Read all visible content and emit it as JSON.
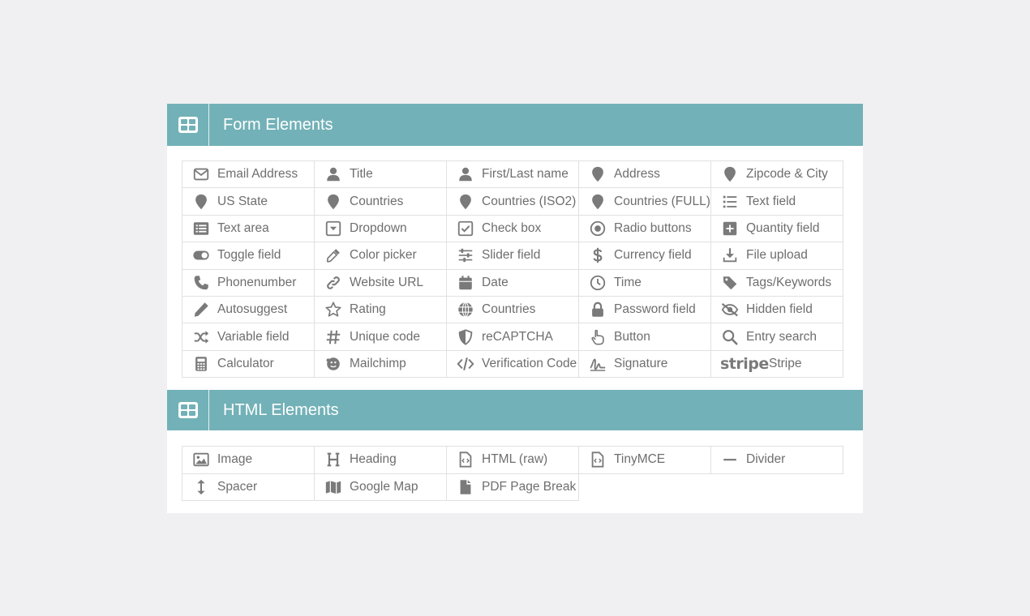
{
  "form_section": {
    "title": "Form Elements",
    "items": [
      {
        "label": "Email Address",
        "icon": "envelope-icon"
      },
      {
        "label": "Title",
        "icon": "user-icon"
      },
      {
        "label": "First/Last name",
        "icon": "user-icon"
      },
      {
        "label": "Address",
        "icon": "map-pin-icon"
      },
      {
        "label": "Zipcode & City",
        "icon": "map-pin-icon"
      },
      {
        "label": "US State",
        "icon": "map-pin-icon"
      },
      {
        "label": "Countries",
        "icon": "map-pin-icon"
      },
      {
        "label": "Countries (ISO2)",
        "icon": "map-pin-icon"
      },
      {
        "label": "Countries (FULL)",
        "icon": "map-pin-icon"
      },
      {
        "label": "Text field",
        "icon": "list-icon"
      },
      {
        "label": "Text area",
        "icon": "list-alt-icon"
      },
      {
        "label": "Dropdown",
        "icon": "caret-square-icon"
      },
      {
        "label": "Check box",
        "icon": "check-square-icon"
      },
      {
        "label": "Radio buttons",
        "icon": "dot-circle-icon"
      },
      {
        "label": "Quantity field",
        "icon": "plus-square-icon"
      },
      {
        "label": "Toggle field",
        "icon": "toggle-icon"
      },
      {
        "label": "Color picker",
        "icon": "eyedropper-icon"
      },
      {
        "label": "Slider field",
        "icon": "sliders-icon"
      },
      {
        "label": "Currency field",
        "icon": "dollar-icon"
      },
      {
        "label": "File upload",
        "icon": "download-icon"
      },
      {
        "label": "Phonenumber",
        "icon": "phone-icon"
      },
      {
        "label": "Website URL",
        "icon": "link-icon"
      },
      {
        "label": "Date",
        "icon": "calendar-icon"
      },
      {
        "label": "Time",
        "icon": "clock-icon"
      },
      {
        "label": "Tags/Keywords",
        "icon": "tag-icon"
      },
      {
        "label": "Autosuggest",
        "icon": "pencil-icon"
      },
      {
        "label": "Rating",
        "icon": "star-icon"
      },
      {
        "label": "Countries",
        "icon": "globe-icon"
      },
      {
        "label": "Password field",
        "icon": "lock-icon"
      },
      {
        "label": "Hidden field",
        "icon": "eye-slash-icon"
      },
      {
        "label": "Variable field",
        "icon": "random-icon"
      },
      {
        "label": "Unique code",
        "icon": "hashtag-icon"
      },
      {
        "label": "reCAPTCHA",
        "icon": "shield-icon"
      },
      {
        "label": "Button",
        "icon": "hand-pointer-icon"
      },
      {
        "label": "Entry search",
        "icon": "search-icon"
      },
      {
        "label": "Calculator",
        "icon": "calculator-icon"
      },
      {
        "label": "Mailchimp",
        "icon": "mailchimp-icon"
      },
      {
        "label": "Verification Code",
        "icon": "code-icon"
      },
      {
        "label": "Signature",
        "icon": "signature-icon"
      },
      {
        "label": "Stripe",
        "icon": "stripe-icon",
        "icon_text": "stripe"
      }
    ]
  },
  "html_section": {
    "title": "HTML Elements",
    "items": [
      {
        "label": "Image",
        "icon": "image-icon"
      },
      {
        "label": "Heading",
        "icon": "heading-icon"
      },
      {
        "label": "HTML (raw)",
        "icon": "file-code-icon"
      },
      {
        "label": "TinyMCE",
        "icon": "file-code-icon"
      },
      {
        "label": "Divider",
        "icon": "minus-icon"
      },
      {
        "label": "Spacer",
        "icon": "arrows-v-icon"
      },
      {
        "label": "Google Map",
        "icon": "map-icon"
      },
      {
        "label": "PDF Page Break",
        "icon": "file-icon"
      }
    ]
  },
  "colors": {
    "header_bg": "#72b1b7",
    "icon": "#7a7a7a",
    "text": "#6e6e6e",
    "cell_border": "#e1e1e1"
  }
}
